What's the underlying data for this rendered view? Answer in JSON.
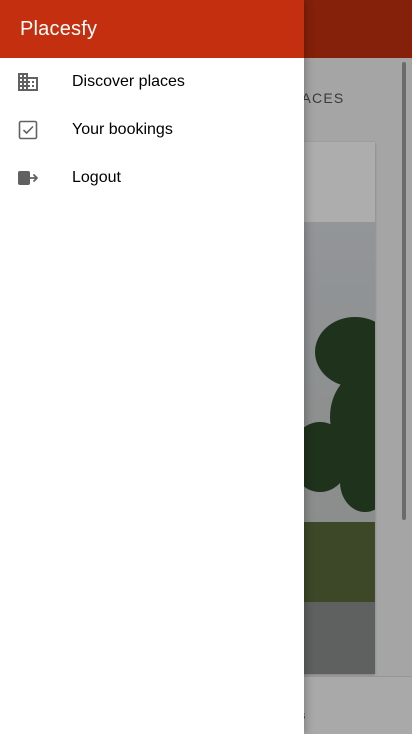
{
  "app": {
    "title": "Placesfy",
    "brand_color": "#c4300f"
  },
  "drawer": {
    "items": [
      {
        "label": "Discover places",
        "icon": "business-icon"
      },
      {
        "label": "Your bookings",
        "icon": "checkbox-icon"
      },
      {
        "label": "Logout",
        "icon": "exit-icon"
      }
    ]
  },
  "background": {
    "tab_label": "PLACES",
    "bottom_label": "s"
  }
}
